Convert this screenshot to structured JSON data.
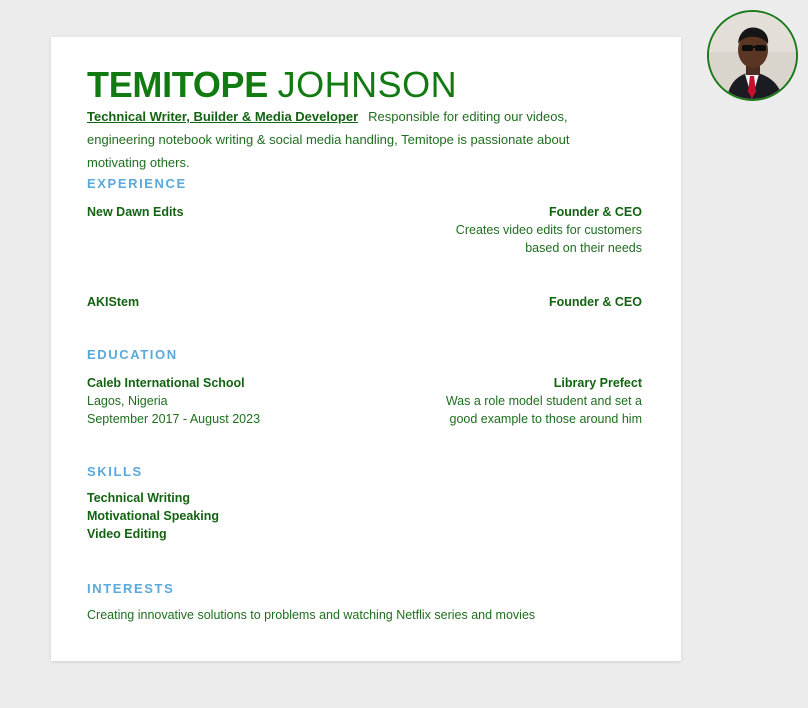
{
  "header": {
    "first_name": "TEMITOPE",
    "last_name": "JOHNSON",
    "role": "Technical Writer, Builder & Media Developer",
    "summary": "Responsible for editing our videos, engineering notebook writing & social media handling, Temitope is passionate about motivating others."
  },
  "experience": {
    "title": "EXPERIENCE",
    "items": [
      {
        "org": "New Dawn Edits",
        "position": "Founder & CEO",
        "desc_line1": "Creates video edits for customers",
        "desc_line2": "based on their needs"
      },
      {
        "org": "AKIStem",
        "position": "Founder & CEO"
      }
    ]
  },
  "education": {
    "title": "EDUCATION",
    "school": "Caleb International School",
    "location": "Lagos, Nigeria",
    "dates": "September 2017 - August 2023",
    "position": "Library Prefect",
    "desc_line1": "Was a role model student and set a",
    "desc_line2": "good example to those around him"
  },
  "skills": {
    "title": "SKILLS",
    "items": [
      "Technical Writing",
      "Motivational Speaking",
      "Video Editing"
    ]
  },
  "interests": {
    "title": "INTERESTS",
    "text": "Creating innovative solutions to problems and watching Netflix series and movies"
  },
  "colors": {
    "name_green": "#117a11",
    "text_green": "#1f6e1f",
    "section_blue": "#5aa9dc",
    "background": "#ececec"
  }
}
